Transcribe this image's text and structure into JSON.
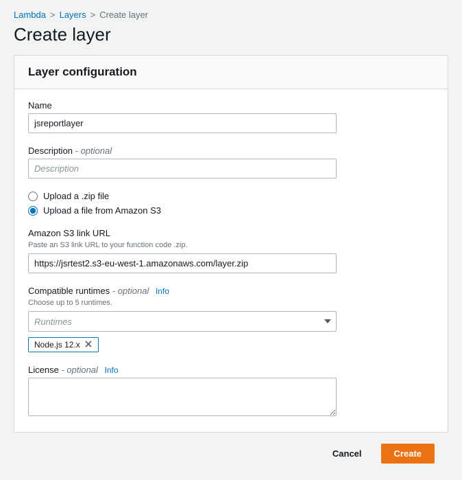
{
  "breadcrumb": {
    "items": [
      "Lambda",
      "Layers"
    ],
    "current": "Create layer",
    "separator": ">"
  },
  "page_title": "Create layer",
  "panel_title": "Layer configuration",
  "name": {
    "label": "Name",
    "value": "jsreportlayer"
  },
  "description": {
    "label": "Description",
    "optional": "- optional",
    "placeholder": "Description",
    "value": ""
  },
  "upload": {
    "options": [
      {
        "label": "Upload a .zip file",
        "selected": false
      },
      {
        "label": "Upload a file from Amazon S3",
        "selected": true
      }
    ]
  },
  "s3": {
    "label": "Amazon S3 link URL",
    "hint": "Paste an S3 link URL to your function code .zip.",
    "value": "https://jsrtest2.s3-eu-west-1.amazonaws.com/layer.zip"
  },
  "runtimes": {
    "label": "Compatible runtimes",
    "optional": "- optional",
    "info": "Info",
    "hint": "Choose up to 5 runtimes.",
    "placeholder": "Runtimes",
    "tags": [
      "Node.js 12.x"
    ]
  },
  "license": {
    "label": "License",
    "optional": "- optional",
    "info": "Info",
    "value": ""
  },
  "actions": {
    "cancel": "Cancel",
    "create": "Create"
  }
}
